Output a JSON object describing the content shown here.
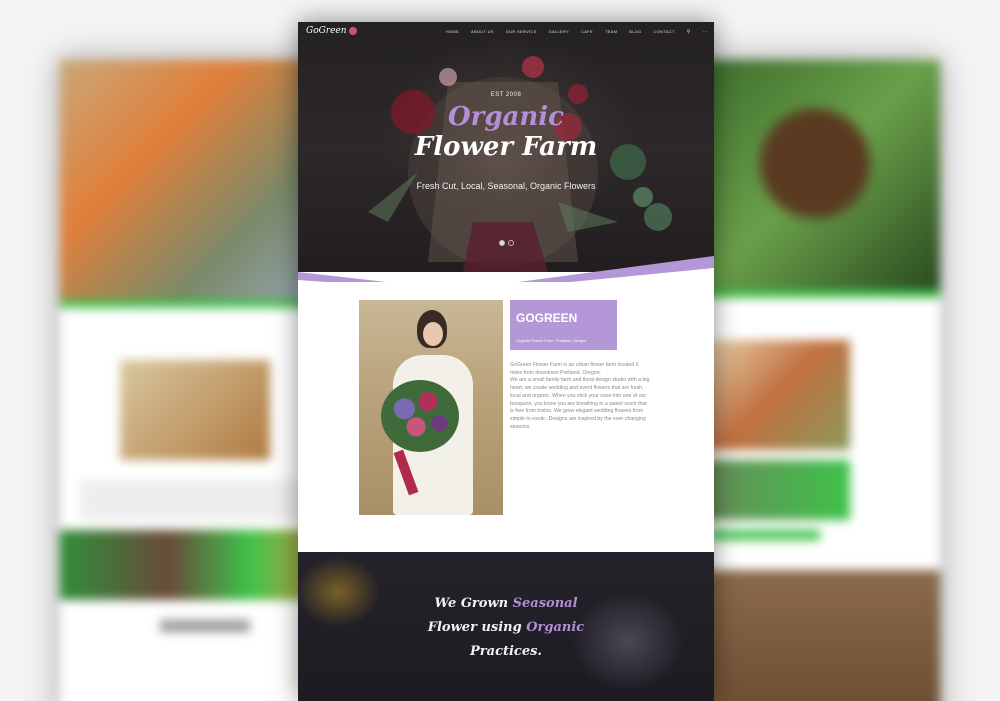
{
  "nav": {
    "logo": "GoGreen",
    "items": [
      "HOME",
      "ABOUT US",
      "OUR SERVICE",
      "GALLERY",
      "CAFE",
      "TEAM",
      "BLOG",
      "CONTACT"
    ],
    "icons": [
      "search-icon",
      "more-icon"
    ]
  },
  "hero": {
    "est": "EST 2008",
    "title_line1": "Organic",
    "title_line2": "Flower Farm",
    "tagline": "Fresh Cut, Local, Seasonal, Organic Flowers"
  },
  "about": {
    "title": "GOGREEN",
    "subtitle": "Organic Flower Farm, Portland, Oregon",
    "paragraph1": "GoGreen Flower Farm is an urban flower farm located 6 miles from downtown Portland, Oregon.",
    "paragraph2": "We are a small family farm and floral design studio with a big heart; we create wedding and event flowers that are fresh, local and organic. When you stick your nose into one of our bouquets, you know you are breathing in a sweet scent that is free from toxins. We grow elegant wedding flowers from simple to exotic. Designs are inspired by the ever-changing seasons."
  },
  "banner": {
    "line1_a": "We Grown ",
    "line1_b": "Seasonal",
    "line2_a": "Flower using ",
    "line2_b": "Organic",
    "line3": "Practices."
  },
  "colors": {
    "accent": "#b497d6",
    "brand_green": "#3ec24a"
  }
}
